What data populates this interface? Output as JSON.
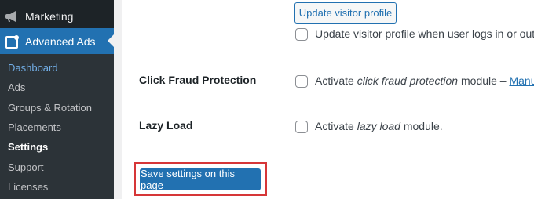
{
  "sidebar": {
    "marketing_label": "Marketing",
    "active_label": "Advanced Ads",
    "items": [
      {
        "label": "Dashboard"
      },
      {
        "label": "Ads"
      },
      {
        "label": "Groups & Rotation"
      },
      {
        "label": "Placements"
      },
      {
        "label": "Settings"
      },
      {
        "label": "Support"
      },
      {
        "label": "Licenses"
      }
    ]
  },
  "settings": {
    "update_profile_button": "Update visitor profile",
    "update_profile_checkbox_label": "Update visitor profile when user logs in or out",
    "click_fraud": {
      "title": "Click Fraud Protection",
      "text_before": "Activate ",
      "text_em": "click fraud protection",
      "text_after": " module – ",
      "link": "Manual"
    },
    "lazy_load": {
      "title": "Lazy Load",
      "text_before": "Activate ",
      "text_em": "lazy load",
      "text_after": " module."
    },
    "save_button": "Save settings on this page"
  },
  "colors": {
    "sidebar_bg": "#1d2327",
    "submenu_bg": "#2c3338",
    "accent": "#2271b1",
    "highlight_border": "#d63638"
  },
  "icons": {
    "marketing": "megaphone-icon",
    "advanced_ads": "advanced-ads-logo-icon"
  }
}
